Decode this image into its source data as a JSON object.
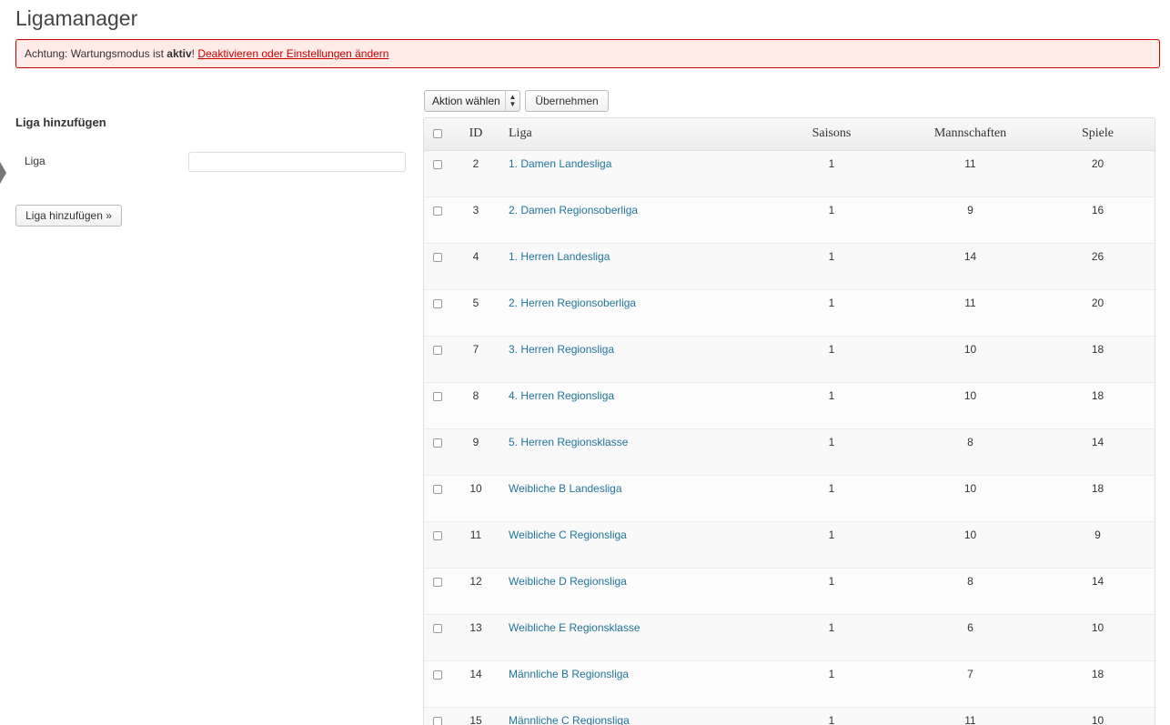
{
  "page": {
    "title": "Ligamanager"
  },
  "notice": {
    "prefix": "Achtung: Wartungsmodus ist ",
    "bold": "aktiv",
    "suffix": "! ",
    "link": "Deaktivieren oder Einstellungen ändern"
  },
  "add_form": {
    "heading": "Liga hinzufügen",
    "label": "Liga",
    "input_value": "",
    "button": "Liga hinzufügen »"
  },
  "bulk": {
    "select_value": "Aktion wählen",
    "apply": "Übernehmen"
  },
  "table": {
    "headers": {
      "id": "ID",
      "liga": "Liga",
      "saisons": "Saisons",
      "mannschaften": "Mannschaften",
      "spiele": "Spiele"
    },
    "rows": [
      {
        "id": "2",
        "liga": "1. Damen Landesliga",
        "saisons": "1",
        "mannschaften": "11",
        "spiele": "20"
      },
      {
        "id": "3",
        "liga": "2. Damen Regionsoberliga",
        "saisons": "1",
        "mannschaften": "9",
        "spiele": "16"
      },
      {
        "id": "4",
        "liga": "1. Herren Landesliga",
        "saisons": "1",
        "mannschaften": "14",
        "spiele": "26"
      },
      {
        "id": "5",
        "liga": "2. Herren Regionsoberliga",
        "saisons": "1",
        "mannschaften": "11",
        "spiele": "20"
      },
      {
        "id": "7",
        "liga": "3. Herren Regionsliga",
        "saisons": "1",
        "mannschaften": "10",
        "spiele": "18"
      },
      {
        "id": "8",
        "liga": "4. Herren Regionsliga",
        "saisons": "1",
        "mannschaften": "10",
        "spiele": "18"
      },
      {
        "id": "9",
        "liga": "5. Herren Regionsklasse",
        "saisons": "1",
        "mannschaften": "8",
        "spiele": "14"
      },
      {
        "id": "10",
        "liga": "Weibliche B Landesliga",
        "saisons": "1",
        "mannschaften": "10",
        "spiele": "18"
      },
      {
        "id": "11",
        "liga": "Weibliche C Regionsliga",
        "saisons": "1",
        "mannschaften": "10",
        "spiele": "9"
      },
      {
        "id": "12",
        "liga": "Weibliche D Regionsliga",
        "saisons": "1",
        "mannschaften": "8",
        "spiele": "14"
      },
      {
        "id": "13",
        "liga": "Weibliche E Regionsklasse",
        "saisons": "1",
        "mannschaften": "6",
        "spiele": "10"
      },
      {
        "id": "14",
        "liga": "Männliche B Regionsliga",
        "saisons": "1",
        "mannschaften": "7",
        "spiele": "18"
      },
      {
        "id": "15",
        "liga": "Männliche C Regionsliga",
        "saisons": "1",
        "mannschaften": "11",
        "spiele": "10"
      }
    ]
  }
}
